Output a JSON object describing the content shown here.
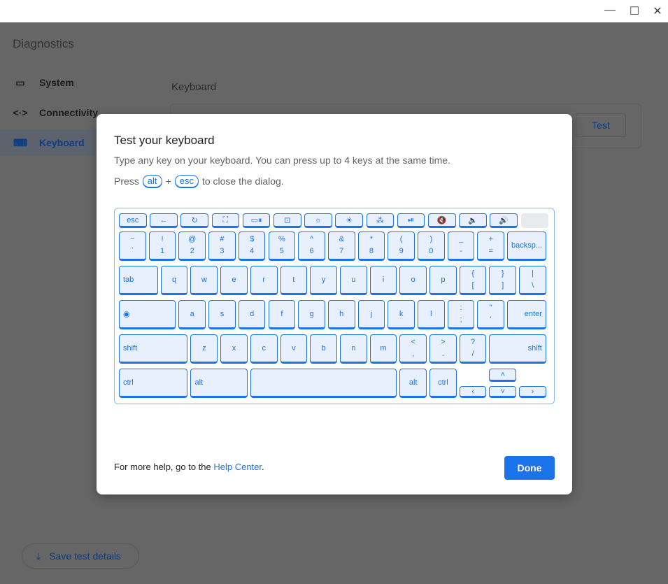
{
  "window": {
    "minimize": "—",
    "maximize": "☐",
    "close": "✕"
  },
  "app": {
    "title": "Diagnostics",
    "nav": [
      {
        "label": "System",
        "icon": "laptop-icon",
        "glyph": "💻"
      },
      {
        "label": "Connectivity",
        "icon": "connectivity-icon",
        "glyph": "<·>"
      },
      {
        "label": "Keyboard",
        "icon": "keyboard-icon",
        "glyph": "⌨"
      }
    ],
    "selected": "Keyboard",
    "section_title": "Keyboard",
    "test_label": "Test",
    "save_label": "Save test details"
  },
  "dialog": {
    "title": "Test your keyboard",
    "subtitle": "Type any key on your keyboard. You can press up to 4 keys at the same time.",
    "press": "Press",
    "plus": "+",
    "key1": "alt",
    "key2": "esc",
    "press_suffix": "to close the dialog.",
    "help_prefix": "For more help, go to the ",
    "help_link": "Help Center",
    "help_suffix": ".",
    "done_label": "Done"
  },
  "keyboard": {
    "top_row": [
      "esc",
      "←",
      "↻",
      "⛶",
      "▭⏸",
      "⊡",
      "☼",
      "☀",
      "⁂",
      "⏯",
      "🔇",
      "🔈",
      "🔊",
      ""
    ],
    "rows": [
      [
        [
          "~",
          "`"
        ],
        [
          "!",
          "1"
        ],
        [
          "@",
          "2"
        ],
        [
          "#",
          "3"
        ],
        [
          "$",
          "4"
        ],
        [
          "%",
          "5"
        ],
        [
          "^",
          "6"
        ],
        [
          "&",
          "7"
        ],
        [
          "*",
          "8"
        ],
        [
          "(",
          "9"
        ],
        [
          ")",
          "0"
        ],
        [
          "_",
          "-"
        ],
        [
          "+",
          "="
        ],
        [
          "backsp..."
        ]
      ],
      [
        [
          "tab"
        ],
        [
          "q"
        ],
        [
          "w"
        ],
        [
          "e"
        ],
        [
          "r"
        ],
        [
          "t"
        ],
        [
          "y"
        ],
        [
          "u"
        ],
        [
          "i"
        ],
        [
          "o"
        ],
        [
          "p"
        ],
        [
          "{",
          "["
        ],
        [
          "}",
          "]"
        ],
        [
          "|",
          "\\"
        ]
      ],
      [
        [
          "◉"
        ],
        [
          "a"
        ],
        [
          "s"
        ],
        [
          "d"
        ],
        [
          "f"
        ],
        [
          "g"
        ],
        [
          "h"
        ],
        [
          "j"
        ],
        [
          "k"
        ],
        [
          "l"
        ],
        [
          ":",
          ";"
        ],
        [
          "\"",
          "'"
        ],
        [
          "enter"
        ]
      ],
      [
        [
          "shift"
        ],
        [
          "z"
        ],
        [
          "x"
        ],
        [
          "c"
        ],
        [
          "v"
        ],
        [
          "b"
        ],
        [
          "n"
        ],
        [
          "m"
        ],
        [
          "<",
          ","
        ],
        [
          ">",
          "."
        ],
        [
          "?",
          "/"
        ],
        [
          "shift"
        ]
      ],
      [
        [
          "ctrl"
        ],
        [
          "alt"
        ],
        [
          ""
        ],
        [
          "alt"
        ],
        [
          "ctrl"
        ]
      ]
    ],
    "arrows": {
      "up": "˄",
      "left": "‹",
      "down": "˅",
      "right": "›"
    }
  }
}
